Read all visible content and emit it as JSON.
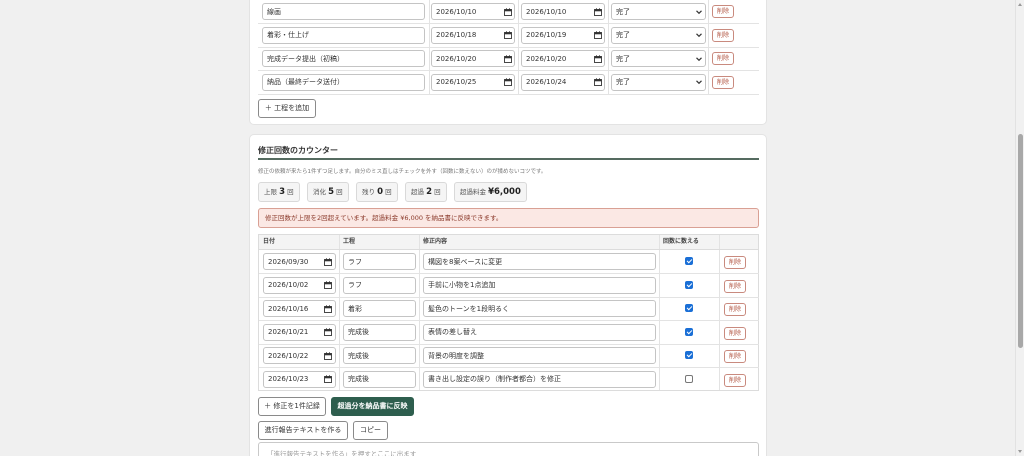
{
  "schedule": {
    "rows": [
      {
        "name": "線画",
        "start": "2026/10/10",
        "end": "2026/10/10",
        "status": "完了",
        "delete_label": "削除"
      },
      {
        "name": "着彩・仕上げ",
        "start": "2026/10/18",
        "end": "2026/10/19",
        "status": "完了",
        "delete_label": "削除"
      },
      {
        "name": "完成データ提出（初稿）",
        "start": "2026/10/20",
        "end": "2026/10/20",
        "status": "完了",
        "delete_label": "削除"
      },
      {
        "name": "納品（最終データ送付）",
        "start": "2026/10/25",
        "end": "2026/10/24",
        "status": "完了",
        "delete_label": "削除"
      }
    ],
    "add_button": "＋ 工程を追加"
  },
  "revisions": {
    "title": "修正回数のカウンター",
    "description": "修正の依頼が来たら1件ずつ足します。自分のミス直しはチェックを外す（回数に数えない）のが揉めないコツです。",
    "stats": [
      {
        "label": "上限",
        "value": "3",
        "unit": "回"
      },
      {
        "label": "消化",
        "value": "5",
        "unit": "回"
      },
      {
        "label": "残り",
        "value": "0",
        "unit": "回"
      },
      {
        "label": "超過",
        "value": "2",
        "unit": "回"
      },
      {
        "label": "超過料金",
        "value": "¥6,000",
        "unit": ""
      }
    ],
    "alert": "修正回数が上限を2回超えています。超過料金 ¥6,000 を納品書に反映できます。",
    "columns": {
      "date": "日付",
      "phase": "工程",
      "content": "修正内容",
      "count": "回数に数える"
    },
    "rows": [
      {
        "date": "2026/09/30",
        "phase": "ラフ",
        "content": "構図を8案ベースに変更",
        "counted": true,
        "delete_label": "削除"
      },
      {
        "date": "2026/10/02",
        "phase": "ラフ",
        "content": "手前に小物を1点追加",
        "counted": true,
        "delete_label": "削除"
      },
      {
        "date": "2026/10/16",
        "phase": "着彩",
        "content": "髪色のトーンを1段明るく",
        "counted": true,
        "delete_label": "削除"
      },
      {
        "date": "2026/10/21",
        "phase": "完成後",
        "content": "表情の差し替え",
        "counted": true,
        "delete_label": "削除"
      },
      {
        "date": "2026/10/22",
        "phase": "完成後",
        "content": "背景の明度を調整",
        "counted": true,
        "delete_label": "削除"
      },
      {
        "date": "2026/10/23",
        "phase": "完成後",
        "content": "書き出し設定の誤り（制作者都合）を修正",
        "counted": false,
        "delete_label": "削除"
      }
    ],
    "add_button": "＋ 修正を1件記録",
    "apply_button": "超過分を納品書に反映",
    "report_button": "進行報告テキストを作る",
    "copy_button": "コピー",
    "output_placeholder": "「進行報告テキストを作る」を押すとここに出ます"
  },
  "icons": {
    "calendar": "calendar-icon",
    "dropdown": "chevron-down-icon"
  },
  "colors": {
    "primary": "#2e5e4e",
    "danger": "#b0523e",
    "alert_bg": "#fbe8e4",
    "check": "#1a6fd6"
  }
}
